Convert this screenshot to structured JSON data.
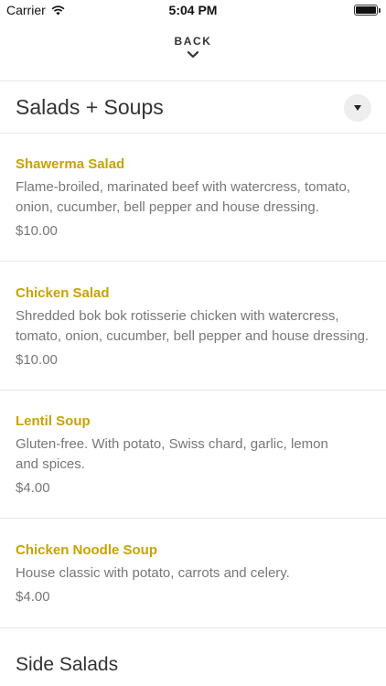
{
  "status_bar": {
    "carrier": "Carrier",
    "time": "5:04 PM"
  },
  "nav": {
    "back_label": "BACK"
  },
  "section": {
    "title": "Salads + Soups"
  },
  "items": [
    {
      "name": "Shawerma Salad",
      "description": "Flame-broiled, marinated beef with watercress, tomato, onion, cucumber, bell pepper and house dressing.",
      "price": "$10.00"
    },
    {
      "name": "Chicken Salad",
      "description": "Shredded bok bok rotisserie chicken with watercress, tomato, onion, cucumber, bell pepper and house dressing.",
      "price": "$10.00"
    },
    {
      "name": "Lentil Soup",
      "description": "Gluten-free. With potato, Swiss chard, garlic, lemon and spices.",
      "price": "$4.00"
    },
    {
      "name": "Chicken Noodle Soup",
      "description": "House classic with potato, carrots and celery.",
      "price": "$4.00"
    }
  ],
  "next_section": {
    "title": "Side Salads"
  },
  "colors": {
    "accent": "#c9a200",
    "text": "#333333",
    "muted": "#777777",
    "divider": "#e6e6e6"
  }
}
